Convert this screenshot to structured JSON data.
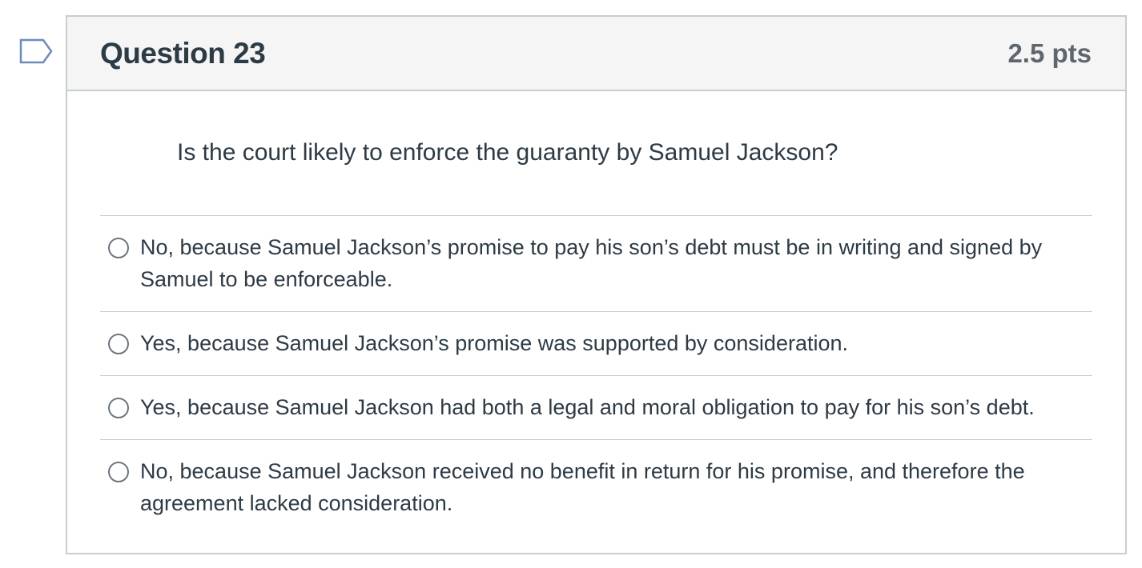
{
  "question": {
    "title": "Question 23",
    "points": "2.5 pts",
    "text": "Is the court likely to enforce the guaranty by Samuel Jackson?",
    "answers": [
      {
        "label": "No, because Samuel Jackson’s promise to pay his son’s debt must be in writing and signed by Samuel to be enforceable."
      },
      {
        "label": "Yes, because Samuel Jackson’s promise was supported by consideration."
      },
      {
        "label": "Yes, because Samuel Jackson had both a legal and moral obligation to pay for his son’s debt."
      },
      {
        "label": "No, because Samuel Jackson received no benefit in return for his promise, and therefore the agreement lacked consideration."
      }
    ]
  },
  "icons": {
    "flag": "flag-question-icon"
  },
  "colors": {
    "border": "#c7cdd1",
    "header_bg": "#f5f5f5",
    "text": "#2d3b45",
    "points": "#5d676d",
    "flag": "#6c8bbf"
  }
}
